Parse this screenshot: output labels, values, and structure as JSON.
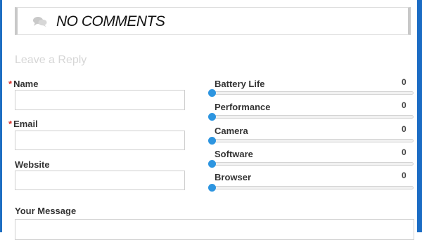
{
  "comments": {
    "title": "NO COMMENTS",
    "icon": "comment-bubbles-icon"
  },
  "reply": {
    "heading": "Leave a Reply"
  },
  "form": {
    "required_marker": "*",
    "name_label": "Name",
    "name_value": "",
    "email_label": "Email",
    "email_value": "",
    "website_label": "Website",
    "website_value": "",
    "message_label": "Your Message",
    "message_value": ""
  },
  "ratings": [
    {
      "label": "Battery Life",
      "value": "0"
    },
    {
      "label": "Performance",
      "value": "0"
    },
    {
      "label": "Camera",
      "value": "0"
    },
    {
      "label": "Software",
      "value": "0"
    },
    {
      "label": "Browser",
      "value": "0"
    }
  ],
  "colors": {
    "accent": "#2d95e0",
    "required": "#d9312b",
    "edge": "#1f6fc2"
  }
}
